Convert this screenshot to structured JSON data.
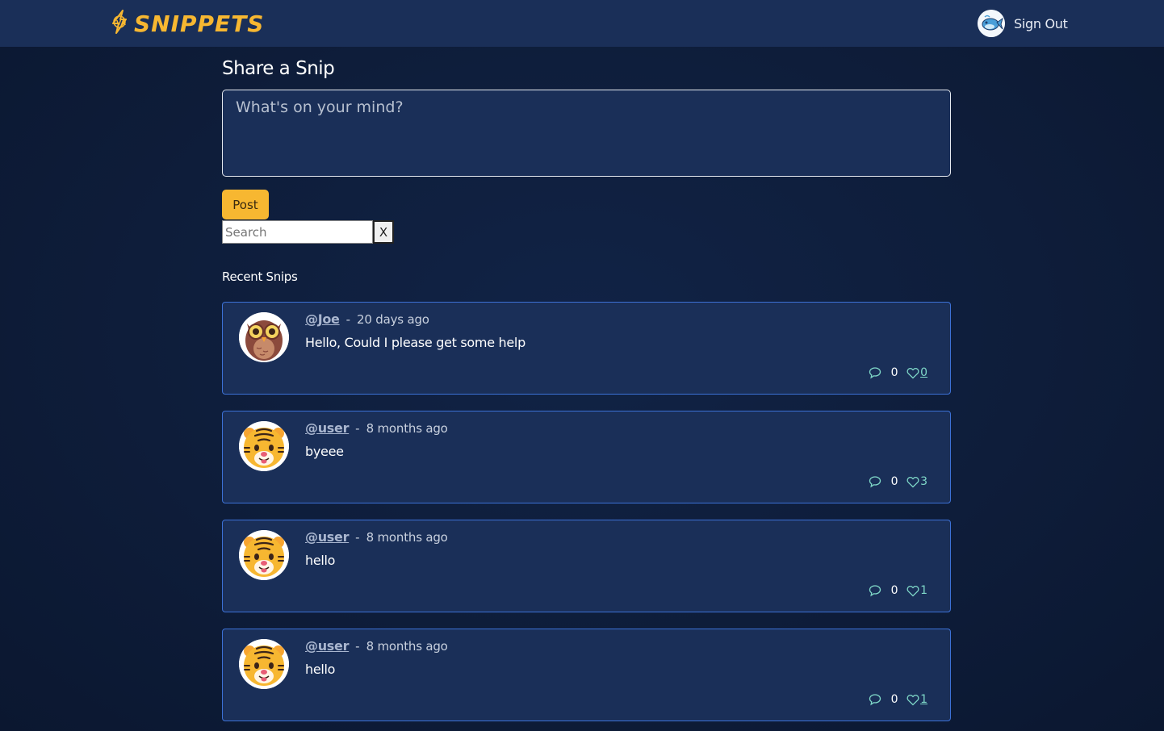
{
  "header": {
    "logo_text": "SNIPPETS",
    "signout_label": "Sign Out"
  },
  "composer": {
    "title": "Share a Snip",
    "placeholder": "What's on your mind?",
    "post_label": "Post"
  },
  "search": {
    "placeholder": "Search",
    "clear_label": "X"
  },
  "feed": {
    "title": "Recent Snips",
    "snips": [
      {
        "handle": "@Joe",
        "separator": "-",
        "time": "20 days ago",
        "text": "Hello, Could I please get some help",
        "comments": "0",
        "likes": "0",
        "avatar": "owl-avatar"
      },
      {
        "handle": "@user",
        "separator": "-",
        "time": "8 months ago",
        "text": "byeee",
        "comments": "0",
        "likes": "3",
        "avatar": "tiger-avatar"
      },
      {
        "handle": "@user",
        "separator": "-",
        "time": "8 months ago",
        "text": "hello",
        "comments": "0",
        "likes": "1",
        "avatar": "tiger-avatar"
      },
      {
        "handle": "@user",
        "separator": "-",
        "time": "8 months ago",
        "text": "hello",
        "comments": "0",
        "likes": "1",
        "avatar": "tiger-avatar"
      }
    ]
  },
  "colors": {
    "background": "#0e1d3a",
    "surface": "#1a2f58",
    "accent": "#f7b731",
    "card_border": "#3c71d6",
    "like": "#7fd8c8"
  }
}
